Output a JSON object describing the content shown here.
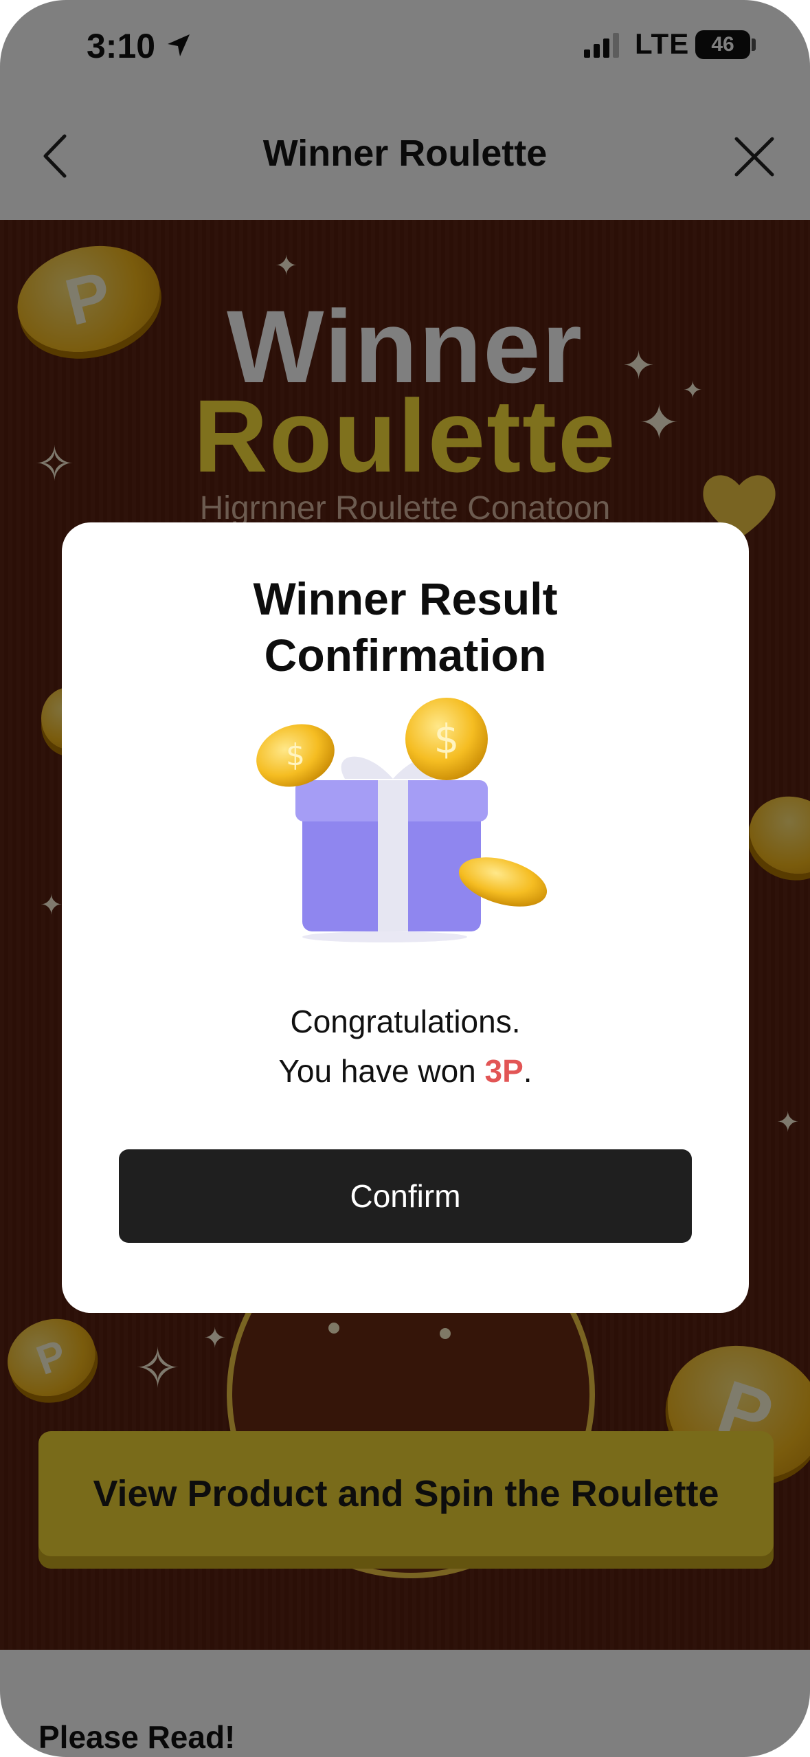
{
  "status_bar": {
    "time": "3:10",
    "network": "LTE",
    "battery": "46",
    "icons": [
      "location-arrow-icon",
      "signal-icon",
      "battery-icon"
    ]
  },
  "nav": {
    "title": "Winner Roulette",
    "icons": [
      "back-chevron-icon",
      "close-icon"
    ]
  },
  "hero": {
    "title_line1": "Winner",
    "title_line2": "Roulette",
    "subtitle": "Higrnner Roulette Conatoon",
    "coin_letter": "P"
  },
  "modal": {
    "title": "Winner Result Confirmation",
    "message_line1": "Congratulations.",
    "message_line2_prefix": "You have won ",
    "amount": "3P",
    "message_line2_suffix": ".",
    "confirm_label": "Confirm",
    "icons": [
      "gift-box-icon",
      "coin-icon"
    ]
  },
  "cta": {
    "label": "View Product and Spin the Roulette"
  },
  "footer": {
    "heading": "Please Read!"
  },
  "colors": {
    "hero_bg": "#5a200f",
    "gold": "#f3d635",
    "amount_red": "#e25555",
    "button_dark": "#1f1f1f"
  }
}
